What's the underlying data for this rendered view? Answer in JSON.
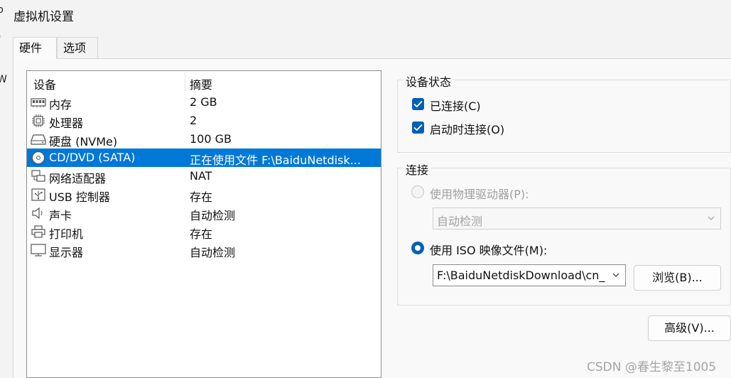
{
  "window": {
    "title": "虚拟机设置"
  },
  "left_edge": [
    "p",
    ")",
    "W"
  ],
  "tabs": [
    {
      "label": "硬件",
      "active": true
    },
    {
      "label": "选项",
      "active": false
    }
  ],
  "device_list": {
    "headers": {
      "device": "设备",
      "summary": "摘要"
    },
    "rows": [
      {
        "icon": "memory-icon",
        "name": "内存",
        "summary": "2 GB"
      },
      {
        "icon": "processor-icon",
        "name": "处理器",
        "summary": "2"
      },
      {
        "icon": "disk-icon",
        "name": "硬盘 (NVMe)",
        "summary": "100 GB"
      },
      {
        "icon": "cd-dvd-icon",
        "name": "CD/DVD (SATA)",
        "summary": "正在使用文件 F:\\BaiduNetdisk...",
        "selected": true
      },
      {
        "icon": "network-adapter-icon",
        "name": "网络适配器",
        "summary": "NAT"
      },
      {
        "icon": "usb-icon",
        "name": "USB 控制器",
        "summary": "存在"
      },
      {
        "icon": "sound-card-icon",
        "name": "声卡",
        "summary": "自动检测"
      },
      {
        "icon": "printer-icon",
        "name": "打印机",
        "summary": "存在"
      },
      {
        "icon": "display-icon",
        "name": "显示器",
        "summary": "自动检测"
      }
    ]
  },
  "device_status": {
    "legend": "设备状态",
    "connected": {
      "label": "已连接(C)",
      "checked": true
    },
    "connect_at_power_on": {
      "label": "启动时连接(O)",
      "checked": true
    }
  },
  "connection": {
    "legend": "连接",
    "physical_drive": {
      "label": "使用物理驱动器(P):",
      "selected": false,
      "dropdown_value": "自动检测"
    },
    "iso_image": {
      "label": "使用 ISO 映像文件(M):",
      "selected": true,
      "path_value": "F:\\BaiduNetdiskDownload\\cn_"
    },
    "browse_label": "浏览(B)..."
  },
  "advanced_label": "高级(V)...",
  "watermark": "CSDN @春生黎至1005",
  "colors": {
    "accent": "#005fb8",
    "selection": "#0078d7"
  }
}
